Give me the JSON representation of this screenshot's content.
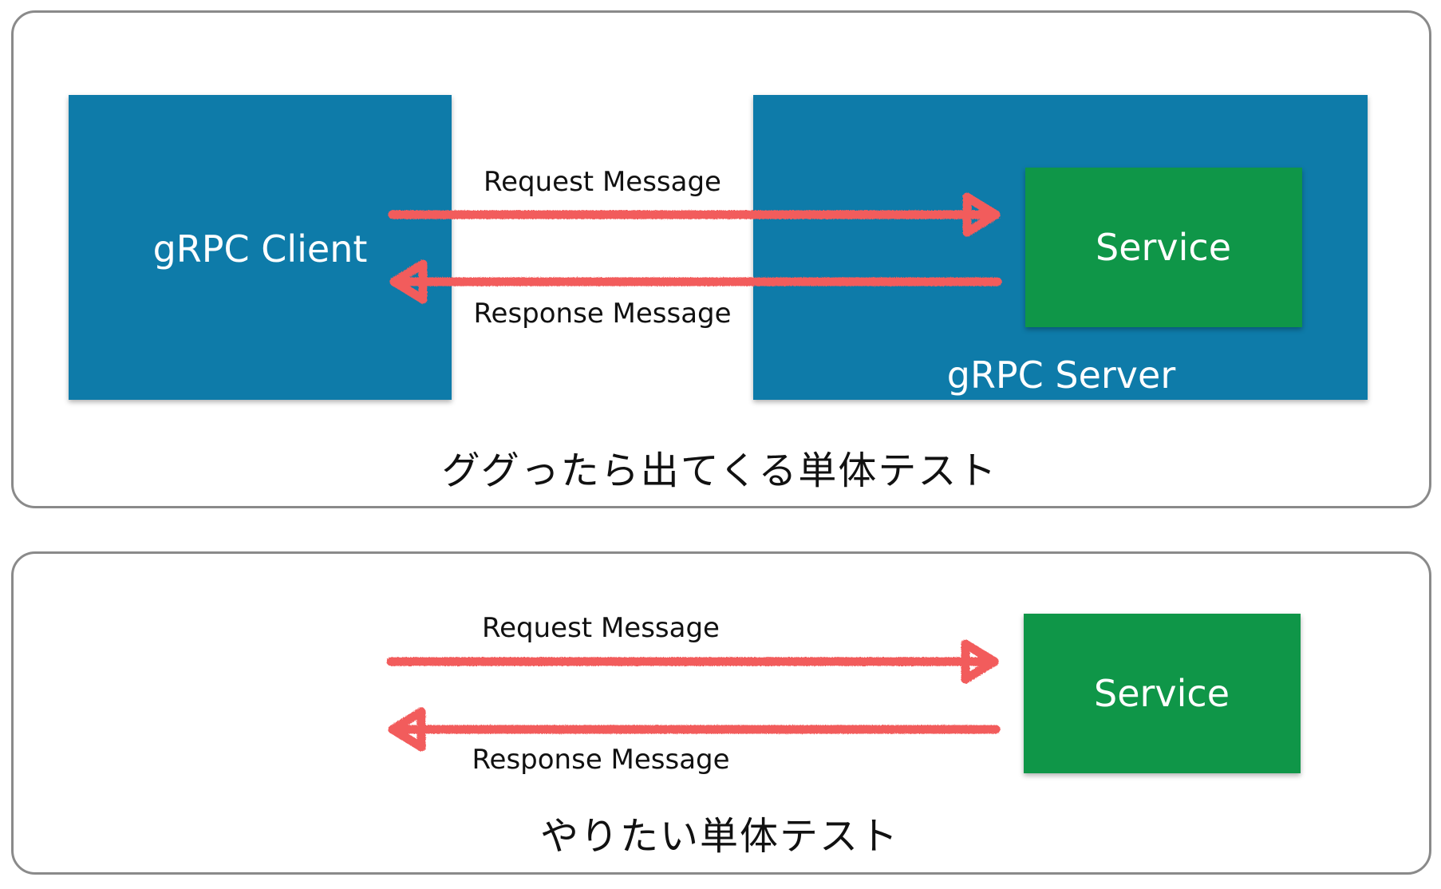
{
  "top_panel": {
    "client_label": "gRPC Client",
    "server_label": "gRPC Server",
    "service_label": "Service",
    "request_label": "Request Message",
    "response_label": "Response Message",
    "caption": "ググったら出てくる単体テスト"
  },
  "bottom_panel": {
    "service_label": "Service",
    "request_label": "Request Message",
    "response_label": "Response Message",
    "caption": "やりたい単体テスト"
  },
  "colors": {
    "client_box": "#0e7ba9",
    "server_box": "#0e7ba9",
    "service_box": "#0f9648",
    "arrow": "#f25c5c",
    "panel_border": "#8a8a8a"
  }
}
